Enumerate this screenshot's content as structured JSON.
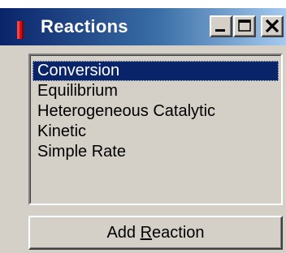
{
  "window": {
    "title": "Reactions",
    "controls": {
      "minimize_icon": "minimize-icon",
      "maximize_icon": "maximize-icon",
      "close_icon": "close-icon"
    },
    "titlebar_colors": {
      "start": "#0a246a",
      "end": "#a6caf0"
    }
  },
  "reaction_list": {
    "selected_index": 0,
    "items": [
      "Conversion",
      "Equilibrium",
      "Heterogeneous Catalytic",
      "Kinetic",
      "Simple Rate"
    ]
  },
  "add_button": {
    "label_before": "Add ",
    "label_mnemonic": "R",
    "label_after": "eaction"
  }
}
